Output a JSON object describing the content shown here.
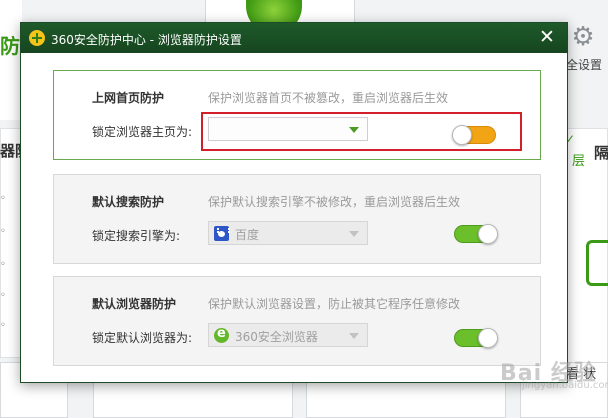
{
  "background": {
    "left_fang": "防",
    "left_title": "器防",
    "gear_label": "全设置",
    "right_ceng": "层",
    "right_ge": "隔",
    "bottom_text": "看 状"
  },
  "dialog": {
    "title": "360安全防护中心 - 浏览器防护设置",
    "close_glyph": "✕"
  },
  "sections": [
    {
      "title": "上网首页防护",
      "description": "保护浏览器首页不被篡改，重启浏览器后生效",
      "field_label": "锁定浏览器主页为:",
      "select_value": "",
      "toggle_state": "off"
    },
    {
      "title": "默认搜索防护",
      "description": "保护默认搜索引擎不被修改，重启浏览器后生效",
      "field_label": "锁定搜索引擎为:",
      "select_value": "百度",
      "select_icon": "baidu-icon",
      "toggle_state": "on"
    },
    {
      "title": "默认浏览器防护",
      "description": "保护默认浏览器设置，防止被其它程序任意修改",
      "field_label": "锁定默认浏览器为:",
      "select_value": "360安全浏览器",
      "select_icon": "browser-360-icon",
      "toggle_state": "on"
    }
  ],
  "watermark": {
    "text": "Bai 经验",
    "sub": "jingyan.baidu.com"
  },
  "colors": {
    "titlebar": "#1e5a2a",
    "toggle_on": "#6abf2b",
    "toggle_off": "#f2a514",
    "highlight": "#d21f2a"
  }
}
